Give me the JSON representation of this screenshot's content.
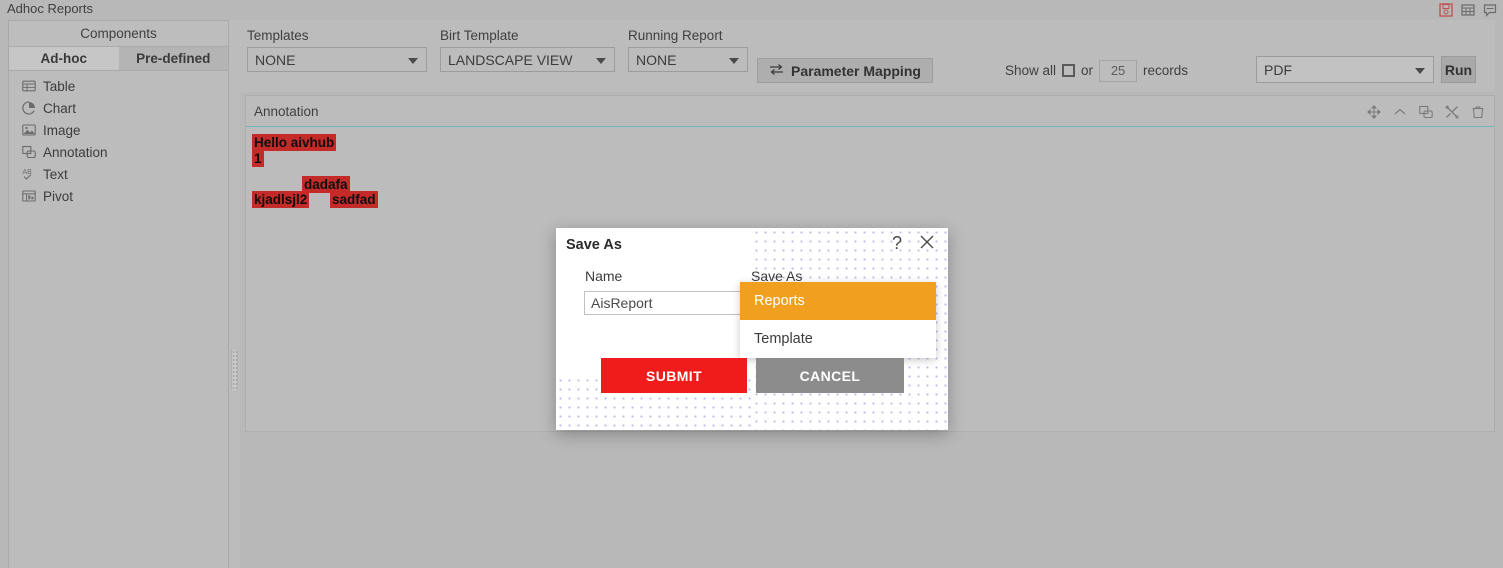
{
  "app": {
    "title": "Adhoc Reports"
  },
  "titlebar": {
    "icons": [
      {
        "name": "save-report-icon",
        "label": "save-report-icon"
      },
      {
        "name": "grid-view-icon",
        "label": "grid-view-icon"
      },
      {
        "name": "comment-icon",
        "label": "comment-icon"
      }
    ]
  },
  "sidebar": {
    "header": "Components",
    "tabs": [
      {
        "label": "Ad-hoc",
        "active": true
      },
      {
        "label": "Pre-defined",
        "active": false
      }
    ],
    "items": [
      {
        "label": "Table",
        "icon": "table-icon"
      },
      {
        "label": "Chart",
        "icon": "pie-chart-icon"
      },
      {
        "label": "Image",
        "icon": "image-icon"
      },
      {
        "label": "Annotation",
        "icon": "annotation-icon"
      },
      {
        "label": "Text",
        "icon": "text-ab-icon"
      },
      {
        "label": "Pivot",
        "icon": "pivot-icon"
      }
    ]
  },
  "toolbar": {
    "templates": {
      "label": "Templates",
      "value": "NONE"
    },
    "birt_template": {
      "label": "Birt Template",
      "value": "LANDSCAPE VIEW"
    },
    "running_report": {
      "label": "Running Report",
      "value": "NONE"
    },
    "parameter_mapping": "Parameter Mapping",
    "show_all_label": "Show all",
    "or_label": "or",
    "records_value": "25",
    "records_label": "records",
    "format": {
      "value": "PDF"
    },
    "run_label": "Run"
  },
  "panel": {
    "title": "Annotation",
    "tools": [
      {
        "name": "move-icon"
      },
      {
        "name": "collapse-chevron-icon"
      },
      {
        "name": "duplicate-icon"
      },
      {
        "name": "settings-tools-icon"
      },
      {
        "name": "delete-trash-icon"
      }
    ],
    "annotation": {
      "line1": "Hello aivhub",
      "line2": "1",
      "line3a": "kjadlsjl2",
      "line3b": "dadafa",
      "line3c": "sadfad"
    }
  },
  "dialog": {
    "title": "Save As",
    "help_glyph": "?",
    "name_label": "Name",
    "name_value": "AisReport",
    "name_placeholder": "Name",
    "saveas_label": "Save As",
    "dropdown_options": [
      {
        "label": "Reports",
        "selected": true
      },
      {
        "label": "Template",
        "selected": false
      }
    ],
    "submit_label": "SUBMIT",
    "cancel_label": "CANCEL"
  },
  "colors": {
    "window_bg": "#b8b8b8",
    "panel_bg": "#bcbcbc",
    "accent_orange": "#f0a01e",
    "submit_red": "#f01c1c",
    "cancel_gray": "#8c8c8c",
    "highlight_red": "#c32a28",
    "panel_top_border": "#6fb7bd",
    "dot_pattern": "#b9c0e8"
  }
}
